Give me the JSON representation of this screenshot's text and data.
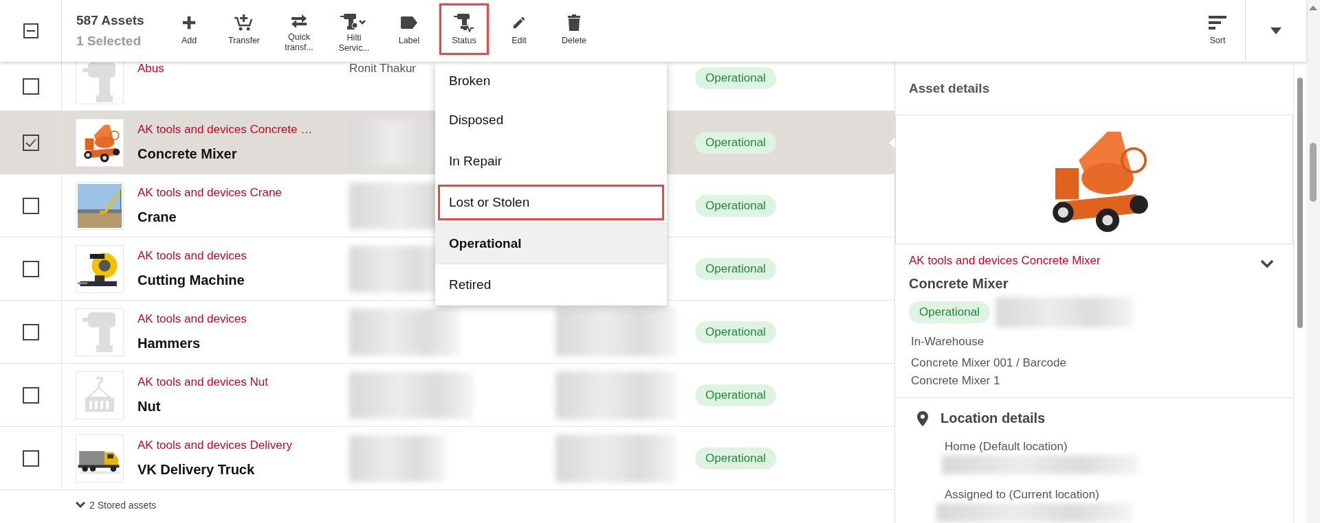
{
  "header_checkbox": {
    "indeterminate": true
  },
  "asset_count": "587 Assets",
  "selected_count": "1 Selected",
  "actions": [
    {
      "label": "Add",
      "highlighted": false
    },
    {
      "label": "Transfer",
      "highlighted": false
    },
    {
      "label": "Quick transf...",
      "highlighted": false
    },
    {
      "label": "Hilti Servic...",
      "highlighted": false
    },
    {
      "label": "Label",
      "highlighted": false
    },
    {
      "label": "Status",
      "highlighted": true
    },
    {
      "label": "Edit",
      "highlighted": false
    },
    {
      "label": "Delete",
      "highlighted": false
    }
  ],
  "sort": {
    "label": "Sort"
  },
  "assets": [
    {
      "brand": "Abus",
      "owner": "Ronit Thakur",
      "status": "Operational",
      "checked": false,
      "selected": false,
      "kind": "tool"
    },
    {
      "brand": "AK tools and devices Concrete …",
      "name": "Concrete Mixer",
      "status": "Operational",
      "checked": true,
      "selected": true,
      "kind": "mixer"
    },
    {
      "brand": "AK tools and devices Crane",
      "name": "Crane",
      "status": "Operational",
      "checked": false,
      "selected": false,
      "kind": "crane"
    },
    {
      "brand": "AK tools and devices",
      "name": "Cutting Machine",
      "status": "Operational",
      "checked": false,
      "selected": false,
      "kind": "cutter"
    },
    {
      "brand": "AK tools and devices",
      "name": "Hammers",
      "status": "Operational",
      "checked": false,
      "selected": false,
      "kind": "tool"
    },
    {
      "brand": "AK tools and devices Nut",
      "name": "Nut",
      "status": "Operational",
      "checked": false,
      "selected": false,
      "kind": "load"
    },
    {
      "brand": "AK tools and devices Delivery",
      "name": "VK Delivery Truck",
      "status": "Operational",
      "checked": false,
      "selected": false,
      "kind": "truck"
    }
  ],
  "stored_assets": "2 Stored assets",
  "status_menu": [
    {
      "label": "Broken",
      "selected": false,
      "highlighted": false
    },
    {
      "label": "Disposed",
      "selected": false,
      "highlighted": false
    },
    {
      "label": "In Repair",
      "selected": false,
      "highlighted": false
    },
    {
      "label": "Lost or Stolen",
      "selected": false,
      "highlighted": true
    },
    {
      "label": "Operational",
      "selected": true,
      "highlighted": false
    },
    {
      "label": "Retired",
      "selected": false,
      "highlighted": false
    }
  ],
  "details": {
    "title": "Asset details",
    "brand": "AK tools and devices Concrete Mixer",
    "name": "Concrete Mixer",
    "status": "Operational",
    "lines": [
      "In-Warehouse",
      "Concrete Mixer 001 / Barcode",
      "Concrete Mixer 1"
    ],
    "location_title": "Location details",
    "location_fields": [
      "Home (Default location)",
      "Assigned to (Current location)"
    ]
  }
}
